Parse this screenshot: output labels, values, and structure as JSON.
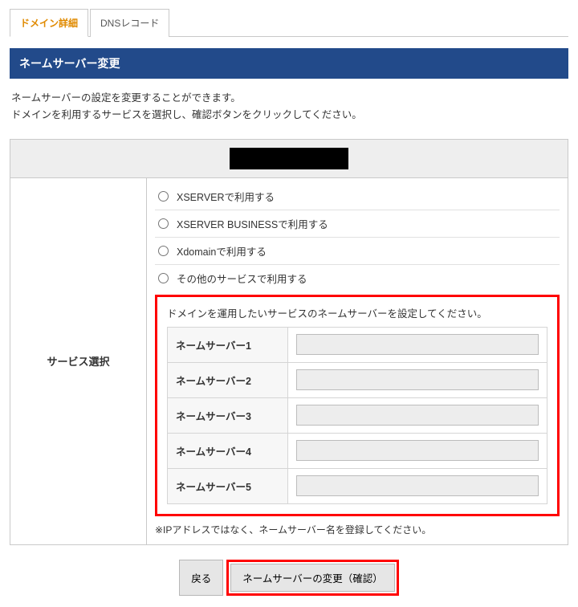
{
  "tabs": {
    "domain_detail": "ドメイン詳細",
    "dns_records": "DNSレコード"
  },
  "section_title": "ネームサーバー変更",
  "intro_line1": "ネームサーバーの設定を変更することができます。",
  "intro_line2": "ドメインを利用するサービスを選択し、確認ボタンをクリックしてください。",
  "side_label": "サービス選択",
  "options": {
    "xserver": "XSERVERで利用する",
    "xserver_business": "XSERVER BUSINESSで利用する",
    "xdomain": "Xdomainで利用する",
    "other": "その他のサービスで利用する"
  },
  "redbox_heading": "ドメインを運用したいサービスのネームサーバーを設定してください。",
  "nameservers": [
    {
      "label": "ネームサーバー1",
      "value": ""
    },
    {
      "label": "ネームサーバー2",
      "value": ""
    },
    {
      "label": "ネームサーバー3",
      "value": ""
    },
    {
      "label": "ネームサーバー4",
      "value": ""
    },
    {
      "label": "ネームサーバー5",
      "value": ""
    }
  ],
  "note": "※IPアドレスではなく、ネームサーバー名を登録してください。",
  "buttons": {
    "back": "戻る",
    "confirm": "ネームサーバーの変更（確認）"
  }
}
